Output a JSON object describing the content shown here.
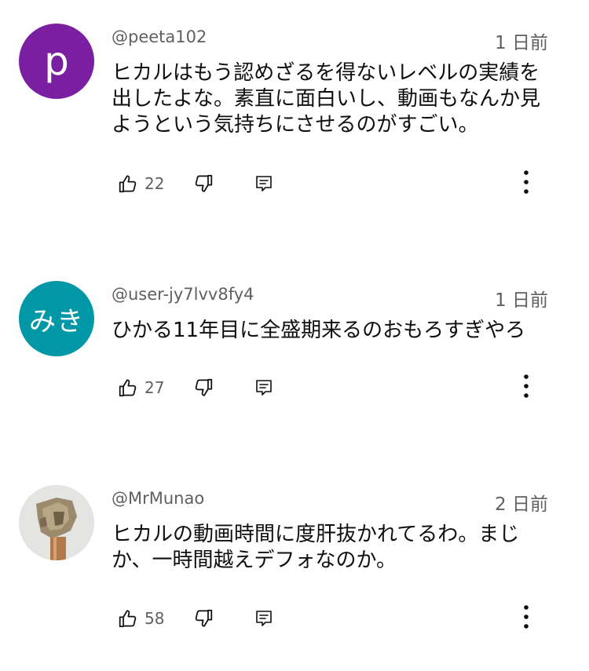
{
  "comments": [
    {
      "avatar_letter": "p",
      "avatar_color": "#7b1fa2",
      "username": "@peeta102",
      "time": "1 日前",
      "text": "ヒカルはもう認めざるを得ないレベルの実績を出したよな。素直に面白いし、動画もなんか見ようという気持ちにさせるのがすごい。",
      "likes": "22"
    },
    {
      "avatar_letter": "みき",
      "avatar_color": "#0097a7",
      "username": "@user-jy7lvv8fy4",
      "time": "1 日前",
      "text": "ひかる11年目に全盛期来るのおもろすぎやろ",
      "likes": "27"
    },
    {
      "avatar_letter": "",
      "avatar_color": "#e6e6e6",
      "username": "@MrMunao",
      "time": "2 日前",
      "text": "ヒカルの動画時間に度肝抜かれてるわ。まじか、一時間越えデフォなのか。",
      "likes": "58"
    }
  ]
}
